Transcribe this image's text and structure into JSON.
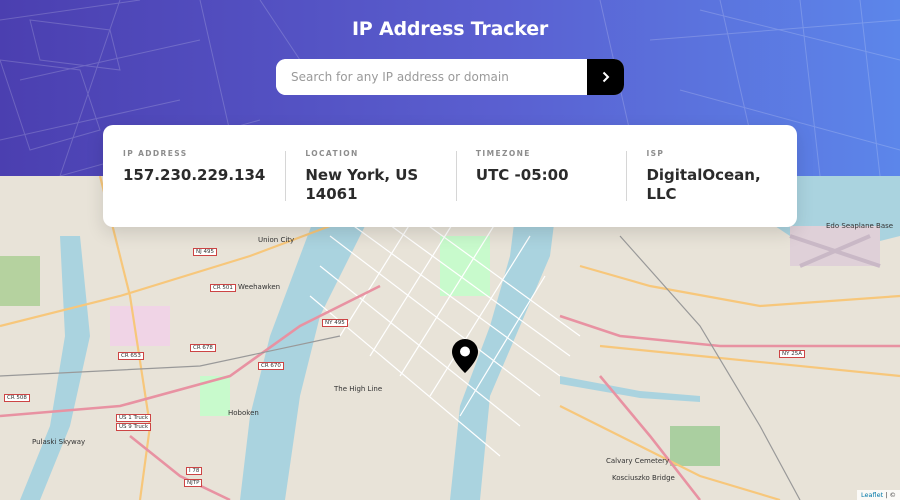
{
  "header": {
    "title": "IP Address Tracker",
    "bg_gradient": [
      "#4b3fb0",
      "#5c86ea"
    ]
  },
  "search": {
    "placeholder": "Search for any IP address or domain",
    "value": "",
    "submit_icon": "chevron-right-icon"
  },
  "info": {
    "ip_label": "IP ADDRESS",
    "ip_value": "157.230.229.134",
    "location_label": "LOCATION",
    "location_value_line1": "New York, US",
    "location_value_line2": "14061",
    "timezone_label": "TIMEZONE",
    "timezone_value": "UTC -05:00",
    "isp_label": "ISP",
    "isp_value_line1": "DigitalOcean,",
    "isp_value_line2": "LLC"
  },
  "map": {
    "labels": {
      "union_city": "Union City",
      "weehawken": "Weehawken",
      "hoboken": "Hoboken",
      "the_high_line": "The High Line",
      "pulaski_skyway": "Pulaski Skyway",
      "calvary_cemetery": "Calvary Cemetery",
      "kosciuszko_bridge": "Kosciuszko Bridge",
      "edo_seaplane_base": "Edo Seaplane Base"
    },
    "shields": {
      "cr501": "CR 501",
      "cr653": "CR 653",
      "cr678": "CR 678",
      "cr670": "CR 670",
      "ny495": "NY 495",
      "nj495": "NJ 495",
      "ny25a": "NY 25A",
      "us1": "US 1 Truck",
      "us9": "US 9 Truck",
      "i78": "I 78",
      "cr508": "CR 508",
      "njtp": "NJTP"
    },
    "marker_icon": "location-pin-icon"
  },
  "attribution": {
    "leaflet": "Leaflet",
    "separator": " | ©"
  }
}
